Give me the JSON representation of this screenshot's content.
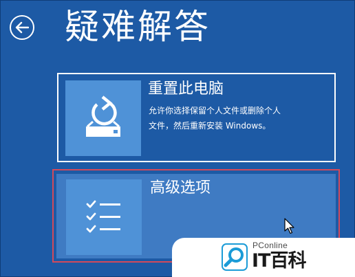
{
  "screen": {
    "title": "疑难解答",
    "back_icon": "back-arrow-icon"
  },
  "options": [
    {
      "id": "reset-pc",
      "title": "重置此电脑",
      "description_line1": "允许你选择保留个人文件或删除个人",
      "description_line2": "文件，然后重新安装 Windows。",
      "icon": "reset-pc-icon",
      "selected": false
    },
    {
      "id": "advanced-options",
      "title": "高级选项",
      "icon": "checklist-icon",
      "selected": true
    }
  ],
  "watermark": {
    "brand_small": "PConline",
    "brand_large": "IT百科",
    "icon": "magnifier-logo-icon"
  },
  "colors": {
    "background": "#1d5aa5",
    "tile": "#4f92d7",
    "selected_card": "#3f7bc3",
    "selection_border": "#d44a5a"
  }
}
